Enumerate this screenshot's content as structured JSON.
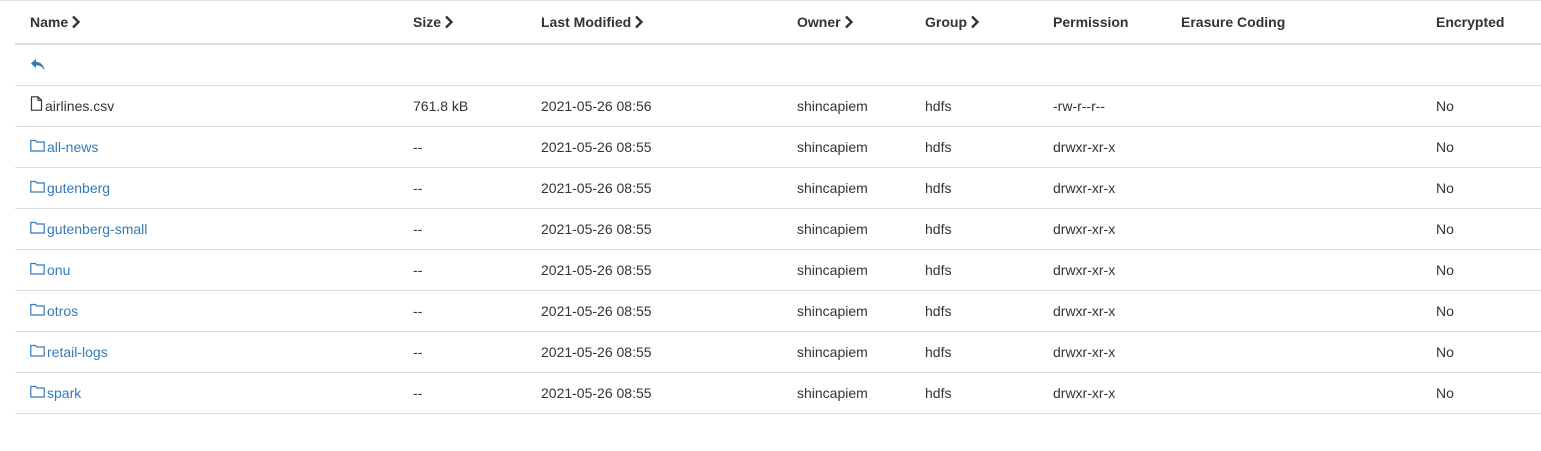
{
  "columns": {
    "name": "Name",
    "size": "Size",
    "last_modified": "Last Modified",
    "owner": "Owner",
    "group": "Group",
    "permission": "Permission",
    "erasure_coding": "Erasure Coding",
    "encrypted": "Encrypted"
  },
  "colors": {
    "link": "#337ab7",
    "text": "#333333",
    "border": "#dddddd"
  },
  "rows": [
    {
      "type": "file",
      "icon": "file-icon",
      "name": "airlines.csv",
      "size": "761.8 kB",
      "modified": "2021-05-26 08:56",
      "owner": "shincapiem",
      "group": "hdfs",
      "permission": "-rw-r--r--",
      "erasure_coding": "",
      "encrypted": "No"
    },
    {
      "type": "folder",
      "icon": "folder-icon",
      "name": "all-news",
      "size": "--",
      "modified": "2021-05-26 08:55",
      "owner": "shincapiem",
      "group": "hdfs",
      "permission": "drwxr-xr-x",
      "erasure_coding": "",
      "encrypted": "No"
    },
    {
      "type": "folder",
      "icon": "folder-icon",
      "name": "gutenberg",
      "size": "--",
      "modified": "2021-05-26 08:55",
      "owner": "shincapiem",
      "group": "hdfs",
      "permission": "drwxr-xr-x",
      "erasure_coding": "",
      "encrypted": "No"
    },
    {
      "type": "folder",
      "icon": "folder-icon",
      "name": "gutenberg-small",
      "size": "--",
      "modified": "2021-05-26 08:55",
      "owner": "shincapiem",
      "group": "hdfs",
      "permission": "drwxr-xr-x",
      "erasure_coding": "",
      "encrypted": "No"
    },
    {
      "type": "folder",
      "icon": "folder-icon",
      "name": "onu",
      "size": "--",
      "modified": "2021-05-26 08:55",
      "owner": "shincapiem",
      "group": "hdfs",
      "permission": "drwxr-xr-x",
      "erasure_coding": "",
      "encrypted": "No"
    },
    {
      "type": "folder",
      "icon": "folder-icon",
      "name": "otros",
      "size": "--",
      "modified": "2021-05-26 08:55",
      "owner": "shincapiem",
      "group": "hdfs",
      "permission": "drwxr-xr-x",
      "erasure_coding": "",
      "encrypted": "No"
    },
    {
      "type": "folder",
      "icon": "folder-icon",
      "name": "retail-logs",
      "size": "--",
      "modified": "2021-05-26 08:55",
      "owner": "shincapiem",
      "group": "hdfs",
      "permission": "drwxr-xr-x",
      "erasure_coding": "",
      "encrypted": "No"
    },
    {
      "type": "folder",
      "icon": "folder-icon",
      "name": "spark",
      "size": "--",
      "modified": "2021-05-26 08:55",
      "owner": "shincapiem",
      "group": "hdfs",
      "permission": "drwxr-xr-x",
      "erasure_coding": "",
      "encrypted": "No"
    }
  ]
}
